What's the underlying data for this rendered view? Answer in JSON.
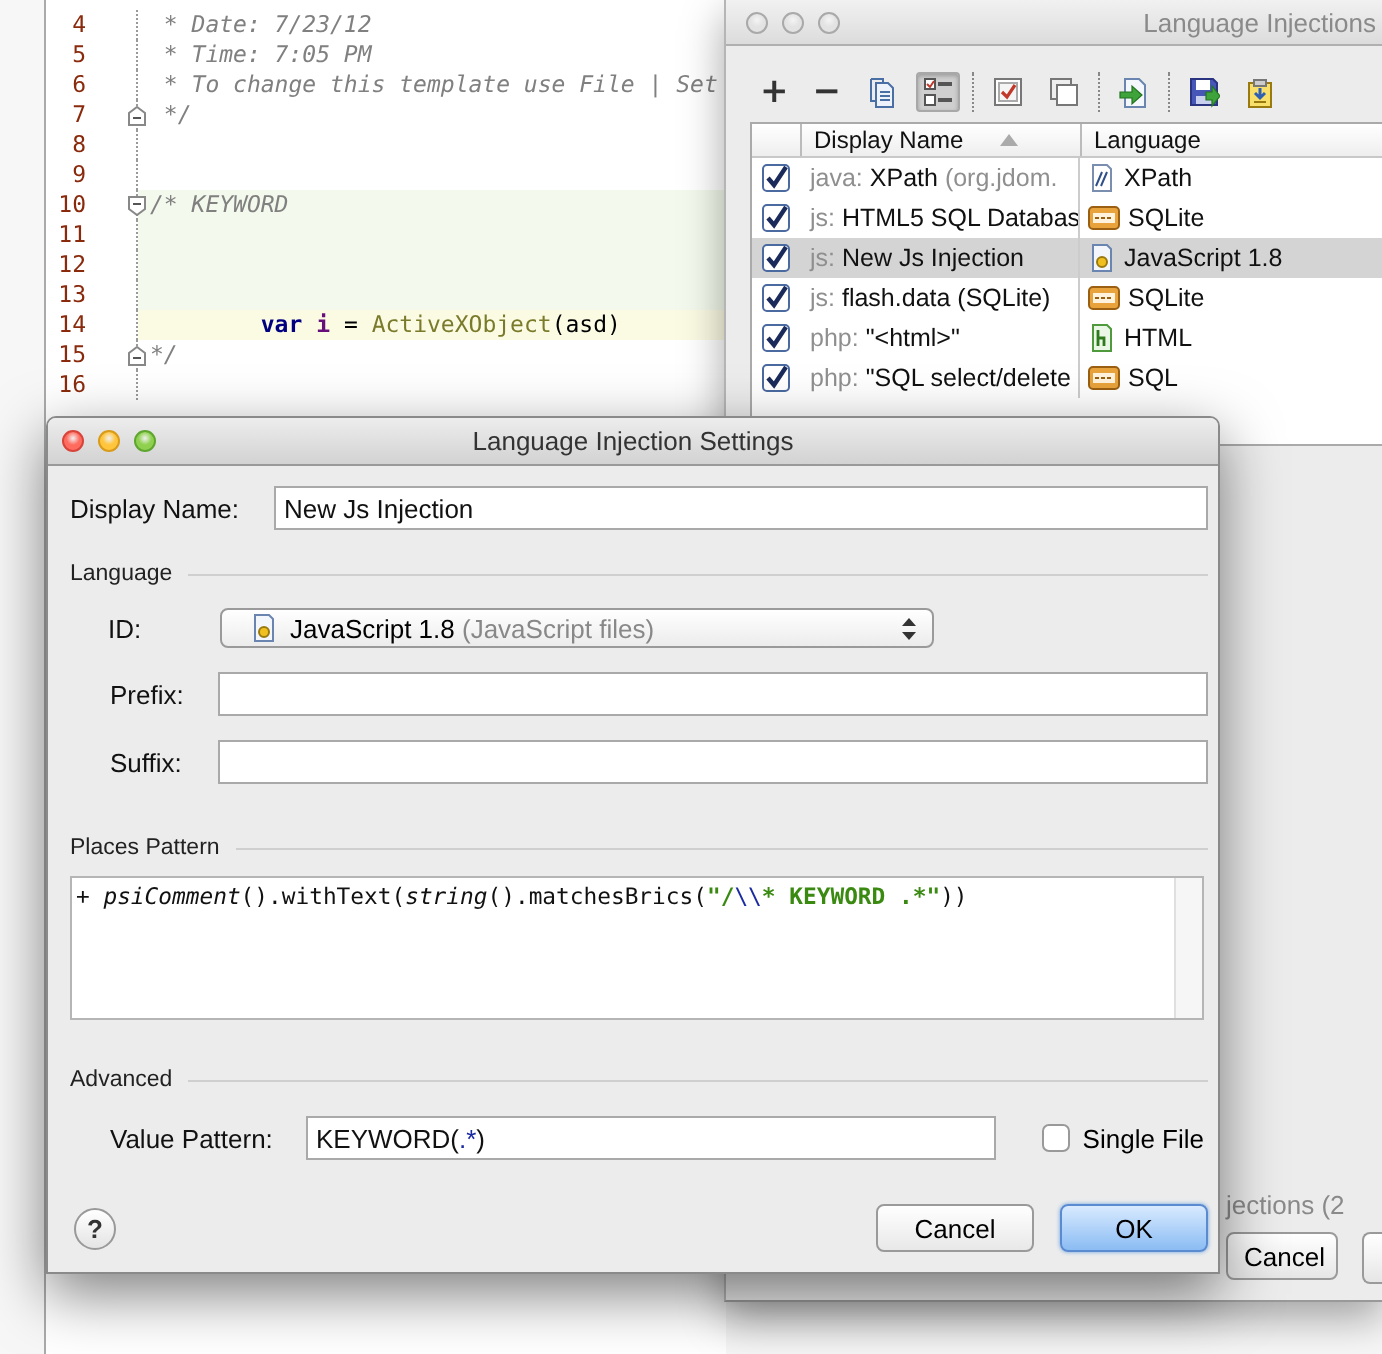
{
  "editor": {
    "lines": [
      {
        "number": "4",
        "kind": "comment",
        "text": " * Date: 7/23/12",
        "fold_start": false,
        "fold_end": false,
        "injected": false,
        "current": false
      },
      {
        "number": "5",
        "kind": "comment",
        "text": " * Time: 7:05 PM",
        "fold_start": false,
        "fold_end": false,
        "injected": false,
        "current": false
      },
      {
        "number": "6",
        "kind": "comment",
        "text": " * To change this template use File | Set",
        "fold_start": false,
        "fold_end": false,
        "injected": false,
        "current": false
      },
      {
        "number": "7",
        "kind": "comment",
        "text": " */",
        "fold_start": false,
        "fold_end": true,
        "injected": false,
        "current": false
      },
      {
        "number": "8",
        "kind": "blank",
        "fold_start": false,
        "fold_end": false,
        "injected": false,
        "current": false
      },
      {
        "number": "9",
        "kind": "blank",
        "fold_start": false,
        "fold_end": false,
        "injected": false,
        "current": false
      },
      {
        "number": "10",
        "kind": "comment",
        "text": "/* KEYWORD",
        "fold_start": true,
        "fold_end": false,
        "injected": true,
        "current": false
      },
      {
        "number": "11",
        "kind": "blank",
        "fold_start": false,
        "fold_end": false,
        "injected": true,
        "current": false
      },
      {
        "number": "12",
        "kind": "blank",
        "fold_start": false,
        "fold_end": false,
        "injected": true,
        "current": false
      },
      {
        "number": "13",
        "kind": "blank",
        "fold_start": false,
        "fold_end": false,
        "injected": true,
        "current": false
      },
      {
        "number": "14",
        "kind": "code",
        "fold_start": false,
        "fold_end": false,
        "injected": false,
        "current": true,
        "tokens": [
          {
            "text": "        var ",
            "kind": "keyword"
          },
          {
            "text": "i",
            "kind": "local"
          },
          {
            "text": " = ",
            "kind": "plain"
          },
          {
            "text": "ActiveXObject",
            "kind": "call"
          },
          {
            "text": "(asd)",
            "kind": "plain"
          }
        ]
      },
      {
        "number": "15",
        "kind": "comment",
        "text": "*/",
        "fold_start": false,
        "fold_end": true,
        "injected": false,
        "current": false
      },
      {
        "number": "16",
        "kind": "blank",
        "fold_start": false,
        "fold_end": false,
        "injected": false,
        "current": false
      }
    ]
  },
  "injections": {
    "title": "Language Injections",
    "active": false,
    "toolbar": [
      {
        "kind": "add",
        "label": "+"
      },
      {
        "kind": "remove",
        "label": "−"
      },
      {
        "kind": "copy"
      },
      {
        "kind": "list",
        "pressed": true
      },
      {
        "kind": "separator"
      },
      {
        "kind": "check-all"
      },
      {
        "kind": "uncheck-all"
      },
      {
        "kind": "separator"
      },
      {
        "kind": "import"
      },
      {
        "kind": "separator"
      },
      {
        "kind": "save"
      },
      {
        "kind": "export"
      }
    ],
    "columns": [
      {
        "label": "Display Name",
        "sorted": true
      },
      {
        "label": "Language",
        "sorted": false
      }
    ],
    "rows": [
      {
        "checked": true,
        "selected": false,
        "prefix": "java:",
        "name": "XPath",
        "suffix": "(org.jdom.",
        "language": "XPath",
        "kind": "xpath"
      },
      {
        "checked": true,
        "selected": false,
        "prefix": "js:",
        "name": "HTML5 SQL Databas",
        "language": "SQLite",
        "kind": "sql"
      },
      {
        "checked": true,
        "selected": true,
        "prefix": "js:",
        "name": "New Js Injection",
        "language": "JavaScript 1.8",
        "kind": "js"
      },
      {
        "checked": true,
        "selected": false,
        "prefix": "js:",
        "name": "flash.data (SQLite)",
        "language": "SQLite",
        "kind": "sql"
      },
      {
        "checked": true,
        "selected": false,
        "prefix": "php:",
        "name": "\"<html>\"",
        "language": "HTML",
        "kind": "html"
      },
      {
        "checked": true,
        "selected": false,
        "prefix": "php:",
        "name": "\"SQL select/delete",
        "language": "SQL",
        "kind": "sql"
      }
    ],
    "status": "jections (2",
    "buttons": [
      "Cancel"
    ]
  },
  "dialog": {
    "title": "Language Injection Settings",
    "active": true,
    "display_name": {
      "label": "Display Name:",
      "value": "New Js Injection"
    },
    "language": {
      "heading": "Language",
      "id": {
        "label": "ID:",
        "value": "JavaScript 1.8",
        "hint": "(JavaScript files)"
      },
      "prefix": {
        "label": "Prefix:"
      },
      "suffix": {
        "label": "Suffix:"
      }
    },
    "places_pattern": {
      "heading": "Places Pattern",
      "tokens": [
        {
          "text": "+ ",
          "kind": "plain"
        },
        {
          "text": "psiComment",
          "kind": "italic"
        },
        {
          "text": "().withText(",
          "kind": "plain"
        },
        {
          "text": "string",
          "kind": "italic"
        },
        {
          "text": "().matchesBrics(",
          "kind": "plain"
        },
        {
          "text": "\"/",
          "kind": "string"
        },
        {
          "text": "\\\\",
          "kind": "escape"
        },
        {
          "text": "* KEYWORD .*\"",
          "kind": "string"
        },
        {
          "text": "))",
          "kind": "plain"
        }
      ]
    },
    "advanced": {
      "heading": "Advanced",
      "value_pattern": {
        "label": "Value Pattern:",
        "tokens": [
          {
            "text": "KEYWORD(",
            "kind": "plain"
          },
          {
            "text": ".*",
            "kind": "escape"
          },
          {
            "text": ")",
            "kind": "plain"
          }
        ]
      },
      "single_file": {
        "label": "Single File",
        "checked": false
      }
    },
    "help": "?",
    "buttons": [
      {
        "label": "Cancel",
        "default": false
      },
      {
        "label": "OK",
        "default": true
      }
    ]
  }
}
